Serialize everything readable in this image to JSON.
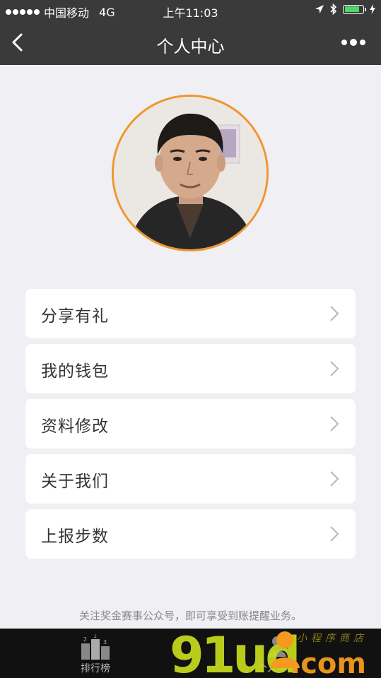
{
  "status_bar": {
    "carrier": "中国移动",
    "network": "4G",
    "time": "上午11:03",
    "battery_level": 0.85
  },
  "nav": {
    "title": "个人中心",
    "back_icon": "chevron-left-icon",
    "more_icon": "more-dots-icon"
  },
  "profile": {
    "avatar_icon": "user-avatar-photo"
  },
  "menu": {
    "items": [
      {
        "label": "分享有礼"
      },
      {
        "label": "我的钱包"
      },
      {
        "label": "资料修改"
      },
      {
        "label": "关于我们"
      },
      {
        "label": "上报步数"
      }
    ]
  },
  "notice": "关注奖金赛事公众号，即可享受到账提醒业务。",
  "tab_bar": {
    "tabs": [
      {
        "label": "排行榜",
        "icon": "podium-icon"
      },
      {
        "label": "个人中心",
        "icon": "user-icon"
      }
    ]
  },
  "watermark": {
    "text": "91ud.com",
    "sub": "小程序商店"
  },
  "colors": {
    "header_bg": "#3a3a3a",
    "page_bg": "#efeff4",
    "accent_orange": "#f0962e",
    "watermark_green": "#c8dc1e",
    "watermark_orange": "#f39a1f"
  }
}
